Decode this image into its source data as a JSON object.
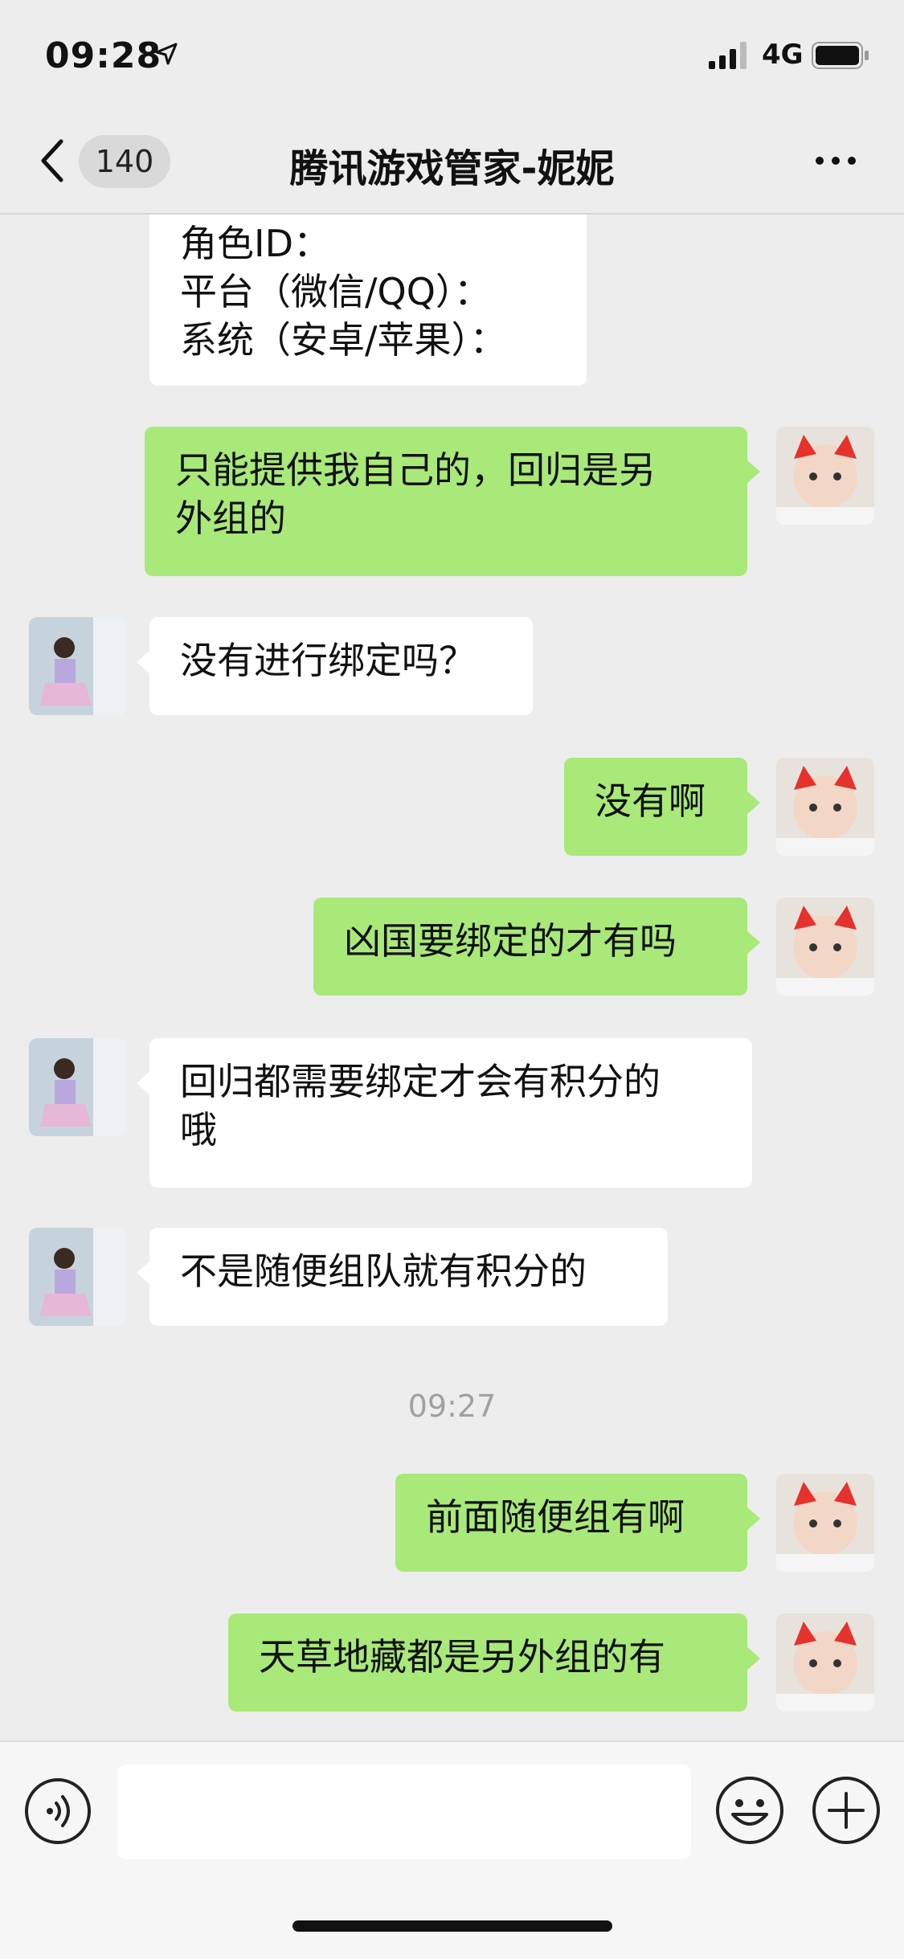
{
  "status_bar": {
    "time": "09:28",
    "network": "4G"
  },
  "nav": {
    "unread_count": "140",
    "title": "腾讯游戏管家-妮妮"
  },
  "messages": [
    {
      "side": "left",
      "lines": [
        "角色ID：",
        "平台（微信/QQ）：",
        "系统（安卓/苹果）："
      ]
    },
    {
      "side": "right",
      "lines": [
        "只能提供我自己的，回归是另",
        "外组的"
      ]
    },
    {
      "side": "left",
      "lines": [
        "没有进行绑定吗？"
      ]
    },
    {
      "side": "right",
      "lines": [
        "没有啊"
      ]
    },
    {
      "side": "right",
      "lines": [
        "凶国要绑定的才有吗"
      ]
    },
    {
      "side": "left",
      "lines": [
        "回归都需要绑定才会有积分的",
        "哦"
      ]
    },
    {
      "side": "left",
      "lines": [
        "不是随便组队就有积分的"
      ]
    },
    {
      "side": "right",
      "lines": [
        "前面随便组有啊"
      ]
    },
    {
      "side": "right",
      "lines": [
        "天草地藏都是另外组的有"
      ]
    }
  ],
  "timestamp": "09:27",
  "input": {
    "placeholder": ""
  },
  "icons": {
    "back": "chevron-left-icon",
    "more": "more-dots-icon",
    "voice": "voice-icon",
    "emoji": "emoji-icon",
    "plus": "plus-icon"
  },
  "colors": {
    "sent_bubble": "#a9e97a",
    "received_bubble": "#ffffff",
    "background": "#ededed"
  }
}
